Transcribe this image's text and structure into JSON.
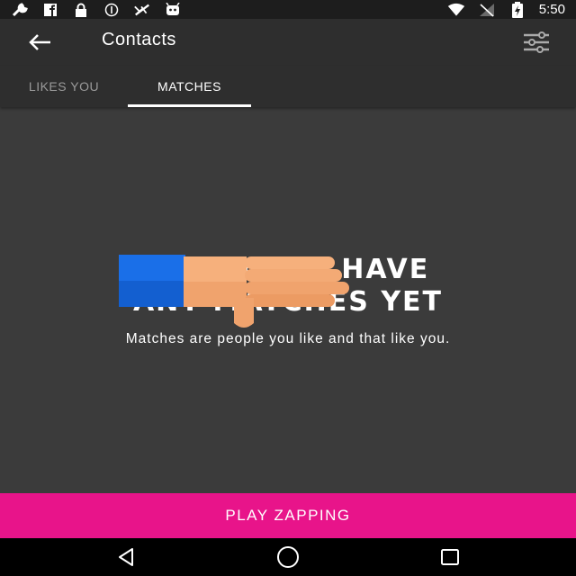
{
  "status_bar": {
    "time": "5:50",
    "icons_left": [
      "wrench-icon",
      "facebook-icon",
      "lock-icon",
      "info-icon",
      "signal-off-icon",
      "android-icon"
    ],
    "icons_right": [
      "wifi-icon",
      "cellular-off-icon",
      "battery-charging-icon"
    ]
  },
  "app_bar": {
    "title": "Contacts",
    "back_icon": "arrow-left-icon",
    "filter_icon": "sliders-icon"
  },
  "tabs": [
    {
      "label": "LIKES YOU",
      "active": false
    },
    {
      "label": "MATCHES",
      "active": true
    }
  ],
  "empty_state": {
    "headline_line1": "YOU DON'T HAVE",
    "headline_line2": "ANY MATCHES YET",
    "subtext": "Matches are people you like and that like you.",
    "illustration": "thumbs-down-icon"
  },
  "cta": {
    "label": "PLAY ZAPPING"
  },
  "nav_bar": {
    "icons": [
      "back-triangle-icon",
      "home-circle-icon",
      "recents-square-icon"
    ]
  },
  "colors": {
    "accent": "#e8148a",
    "background": "#3b3b3b",
    "appbar": "#2e2e2e",
    "statusbar": "#1d1d1d",
    "cuff": "#1a6fe8",
    "hand": "#f6b07c"
  }
}
